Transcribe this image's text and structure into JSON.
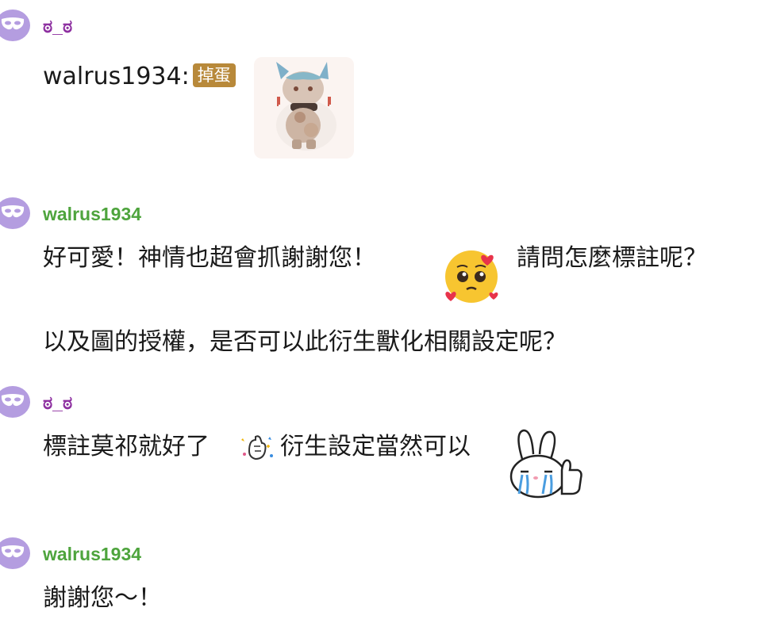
{
  "messages": [
    {
      "username": "ಠ_ಠ",
      "name_color": "#8d2fa0",
      "text_prefix": "walrus1934:",
      "badge": "掉蛋",
      "sticker": "chibi-character-sticker"
    },
    {
      "username": "walrus1934",
      "name_color": "#4ea43d",
      "line1_part1": "好可愛！神情也超會抓謝謝您！",
      "emoji": "smiling-face-with-hearts-emoji",
      "line1_part2": "請問怎麼標註呢？",
      "line2": "以及圖的授權，是否可以此衍生獸化相關設定呢？"
    },
    {
      "username": "ಠ_ಠ",
      "name_color": "#8d2fa0",
      "text_part1": "標註莫祁就好了",
      "emoji": "sparkle-hand-emoji",
      "text_part2": "衍生設定當然可以",
      "sticker": "crying-bunny-thumbs-up-sticker"
    },
    {
      "username": "walrus1934",
      "name_color": "#4ea43d",
      "text": "謝謝您～！"
    }
  ],
  "avatar_icon": "mask-icon"
}
